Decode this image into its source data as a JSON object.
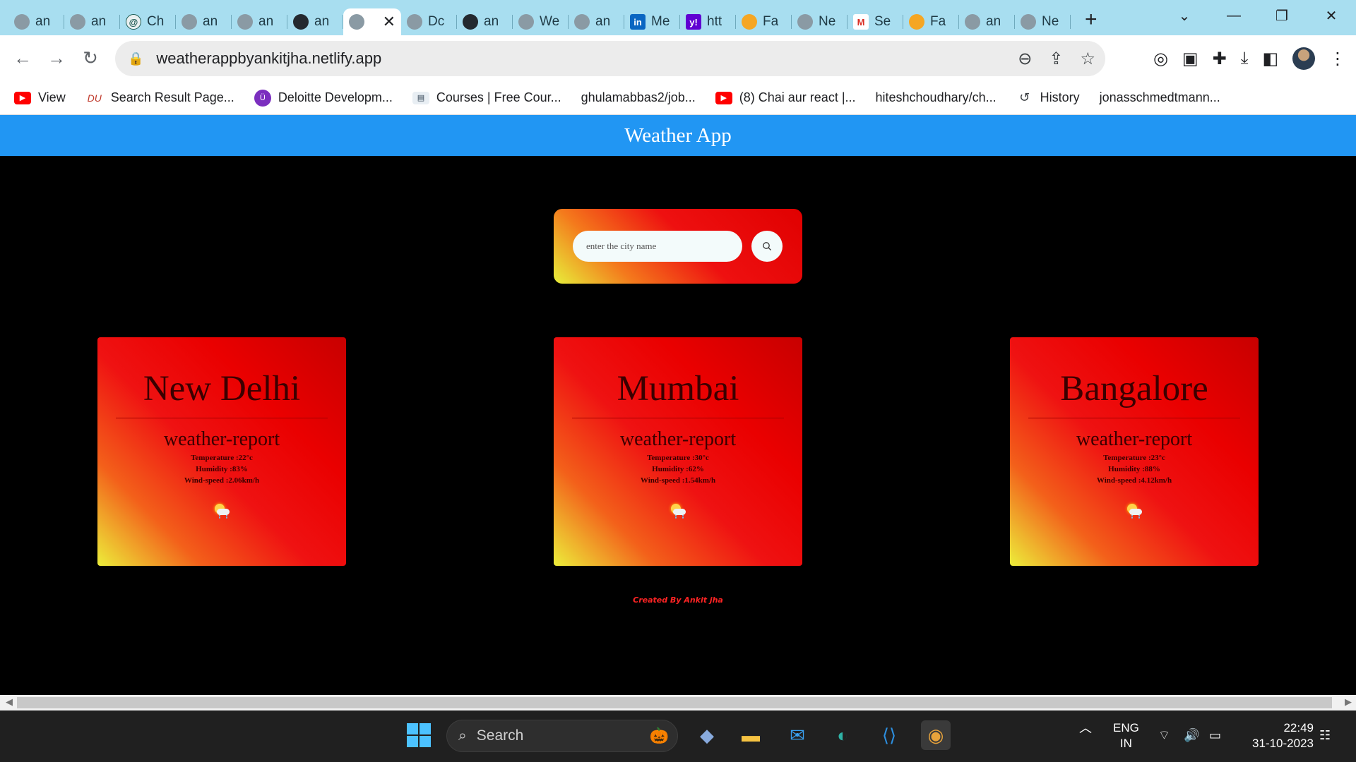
{
  "browser": {
    "tabs": [
      {
        "title": "an",
        "icon": "globe-icon",
        "glyph": ""
      },
      {
        "title": "an",
        "icon": "globe-icon",
        "glyph": ""
      },
      {
        "title": "Ch",
        "icon": "chatgpt-icon",
        "glyph": "@"
      },
      {
        "title": "an",
        "icon": "globe-icon",
        "glyph": ""
      },
      {
        "title": "an",
        "icon": "globe-icon",
        "glyph": ""
      },
      {
        "title": "an",
        "icon": "github-icon",
        "glyph": ""
      },
      {
        "title": "",
        "icon": "globe-icon",
        "glyph": "",
        "active": true
      },
      {
        "title": "Dc",
        "icon": "globe-icon",
        "glyph": ""
      },
      {
        "title": "an",
        "icon": "github-icon",
        "glyph": ""
      },
      {
        "title": "We",
        "icon": "globe-icon",
        "glyph": ""
      },
      {
        "title": "an",
        "icon": "globe-icon",
        "glyph": ""
      },
      {
        "title": "Me",
        "icon": "linkedin-icon",
        "glyph": "in"
      },
      {
        "title": "htt",
        "icon": "yahoo-icon",
        "glyph": "y!"
      },
      {
        "title": "Fa",
        "icon": "pizza-icon",
        "glyph": ""
      },
      {
        "title": "Ne",
        "icon": "globe-icon",
        "glyph": ""
      },
      {
        "title": "Se",
        "icon": "gmail-icon",
        "glyph": "M"
      },
      {
        "title": "Fa",
        "icon": "pizza-icon",
        "glyph": ""
      },
      {
        "title": "an",
        "icon": "globe-icon",
        "glyph": ""
      },
      {
        "title": "Ne",
        "icon": "globe-icon",
        "glyph": ""
      }
    ],
    "url": "weatherappbyankitjha.netlify.app",
    "bookmarks": [
      {
        "label": "View",
        "icon": "youtube-icon",
        "glyph": "▶"
      },
      {
        "label": "Search Result Page...",
        "icon": "du-icon",
        "glyph": "DU"
      },
      {
        "label": "Deloitte Developm...",
        "icon": "deloitte-icon",
        "glyph": "Ü"
      },
      {
        "label": "Courses | Free Cour...",
        "icon": "courses-icon",
        "glyph": "▤"
      },
      {
        "label": "ghulamabbas2/job...",
        "icon": "",
        "glyph": ""
      },
      {
        "label": "(8) Chai aur react |...",
        "icon": "youtube-icon",
        "glyph": "▶"
      },
      {
        "label": "hiteshchoudhary/ch...",
        "icon": "",
        "glyph": ""
      },
      {
        "label": "History",
        "icon": "history-icon",
        "glyph": "↺"
      },
      {
        "label": "jonasschmedtmann...",
        "icon": "",
        "glyph": ""
      }
    ]
  },
  "app": {
    "title": "Weather App",
    "search_placeholder": "enter the city name",
    "report_label": "weather-report",
    "cities": [
      {
        "name": "New Delhi",
        "temperature": "Temperature :22°c",
        "humidity": "Humidity :83%",
        "wind": "Wind-speed :2.06km/h"
      },
      {
        "name": "Mumbai",
        "temperature": "Temperature :30°c",
        "humidity": "Humidity :62%",
        "wind": "Wind-speed :1.54km/h"
      },
      {
        "name": "Bangalore",
        "temperature": "Temperature :23°c",
        "humidity": "Humidity :88%",
        "wind": "Wind-speed :4.12km/h"
      }
    ],
    "footer": "Created By Ankit jha",
    "colors": {
      "navbar": "#2196f3",
      "card_red": "#ea0000",
      "card_yellow": "#ecee3a",
      "footer": "#ff2424"
    }
  },
  "taskbar": {
    "search_label": "Search",
    "language": "ENG",
    "region": "IN",
    "time": "22:49",
    "date": "31-10-2023"
  }
}
